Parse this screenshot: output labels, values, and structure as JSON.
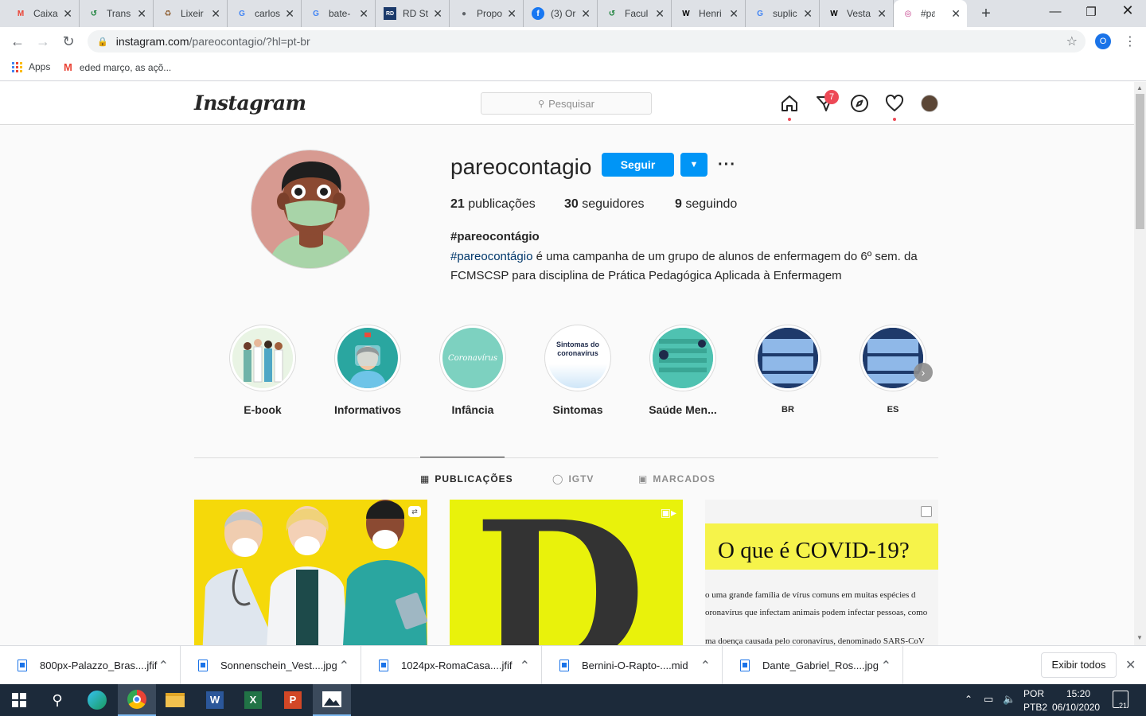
{
  "browser": {
    "tabs": [
      {
        "title": "Caixa",
        "favicon": "gmail-icon",
        "color": "#ea4335"
      },
      {
        "title": "Trans",
        "favicon": "translate-icon",
        "color": "#188038"
      },
      {
        "title": "Lixeir",
        "favicon": "recycle-icon",
        "color": "#8b5a2b"
      },
      {
        "title": "carlos",
        "favicon": "google-icon",
        "color": "#4285f4"
      },
      {
        "title": "bate-",
        "favicon": "google-icon",
        "color": "#4285f4"
      },
      {
        "title": "RD St",
        "favicon": "rd-icon",
        "color": "#1b3a6b"
      },
      {
        "title": "Propo",
        "favicon": "globe-icon",
        "color": "#5f6368"
      },
      {
        "title": "(3) Or",
        "favicon": "facebook-icon",
        "color": "#1877f2"
      },
      {
        "title": "Facul",
        "favicon": "translate-icon",
        "color": "#188038"
      },
      {
        "title": "Henri",
        "favicon": "wikipedia-icon",
        "color": "#000000"
      },
      {
        "title": "suplic",
        "favicon": "google-icon",
        "color": "#4285f4"
      },
      {
        "title": "Vesta",
        "favicon": "wikipedia-icon",
        "color": "#000000"
      },
      {
        "title": "#parc",
        "favicon": "instagram-icon",
        "color": "#c13584",
        "active": true
      }
    ],
    "url_host": "instagram.com",
    "url_path": "/pareocontagio/?hl=pt-br",
    "profile_initial": "O",
    "bookmarks": [
      {
        "label": "Apps",
        "icon": "apps-grid-icon"
      },
      {
        "label": "eded março, as açõ...",
        "icon": "gmail-icon"
      }
    ]
  },
  "instagram": {
    "search_placeholder": "Pesquisar",
    "dm_badge": "7",
    "profile": {
      "username": "pareocontagio",
      "follow_label": "Seguir",
      "posts_count": "21",
      "posts_label": "publicações",
      "followers_count": "30",
      "followers_label": "seguidores",
      "following_count": "9",
      "following_label": "seguindo",
      "full_name": "#pareocontágio",
      "bio_tag": "#pareocontágio",
      "bio_rest": "é uma campanha de um grupo de alunos de enfermagem do 6º sem. da FCMSCSP para disciplina de Prática Pedagógica Aplicada à Enfermagem"
    },
    "highlights": [
      {
        "label": "E-book"
      },
      {
        "label": "Informativos"
      },
      {
        "label": "Infância",
        "image_text": "Coronavírus"
      },
      {
        "label": "Sintomas",
        "image_text": "Sintomas do coronavírus"
      },
      {
        "label": "Saúde Men..."
      },
      {
        "label": "BR"
      },
      {
        "label": "ES"
      }
    ],
    "tabs": [
      {
        "label": "PUBLICAÇÕES",
        "icon": "grid-icon",
        "active": true
      },
      {
        "label": "IGTV",
        "icon": "igtv-icon"
      },
      {
        "label": "MARCADOS",
        "icon": "tagged-icon"
      }
    ],
    "posts": [
      {
        "kind": "illustration-doctors",
        "bg": "#f5d90a"
      },
      {
        "kind": "letter-D",
        "bg": "#e9f20b",
        "letter": "D"
      },
      {
        "kind": "covid-text",
        "heading": "O que é COVID-19?",
        "line1": "o uma grande família de vírus comuns em muitas espécies d",
        "line2": "oronavírus que infectam animais podem infectar pessoas, como",
        "line3": "ma doença causada pelo coronavírus, denominado SARS-CoV"
      }
    ]
  },
  "downloads": {
    "items": [
      "800px-Palazzo_Bras....jfif",
      "Sonnenschein_Vest....jpg",
      "1024px-RomaCasa....jfif",
      "Bernini-O-Rapto-....mid",
      "Dante_Gabriel_Ros....jpg"
    ],
    "show_all": "Exibir todos"
  },
  "taskbar": {
    "lang1": "POR",
    "lang2": "PTB2",
    "time": "15:20",
    "date": "06/10/2020",
    "notif_count": "21"
  }
}
